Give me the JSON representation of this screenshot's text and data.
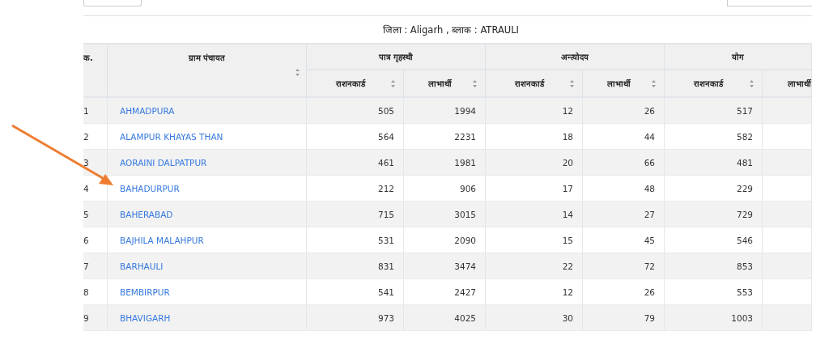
{
  "caption": "जिला : Aligarh , ब्लाक : ATRAULI",
  "header_groups": [
    {
      "label": "क.",
      "sortable": false
    },
    {
      "label": "ग्राम पंचायत",
      "sortable": true
    },
    {
      "label": "पात्र गृहस्थी"
    },
    {
      "label": "अन्त्योदय"
    },
    {
      "label": "योग"
    }
  ],
  "sub_columns": [
    {
      "label": "राशनकार्ड",
      "sortable": true
    },
    {
      "label": "लाभार्थी",
      "sortable": true
    },
    {
      "label": "राशनकार्ड",
      "sortable": true
    },
    {
      "label": "लाभार्थी",
      "sortable": true
    },
    {
      "label": "राशनकार्ड",
      "sortable": true
    },
    {
      "label": "लाभार्थी",
      "sortable": false
    }
  ],
  "rows": [
    {
      "sno": "1",
      "village": "AHMADPURA",
      "values": [
        "505",
        "1994",
        "12",
        "26",
        "517"
      ]
    },
    {
      "sno": "2",
      "village": "ALAMPUR KHAYAS THAN",
      "values": [
        "564",
        "2231",
        "18",
        "44",
        "582"
      ]
    },
    {
      "sno": "3",
      "village": "AORAINI DALPATPUR",
      "values": [
        "461",
        "1981",
        "20",
        "66",
        "481"
      ]
    },
    {
      "sno": "4",
      "village": "BAHADURPUR",
      "values": [
        "212",
        "906",
        "17",
        "48",
        "229"
      ]
    },
    {
      "sno": "5",
      "village": "BAHERABAD",
      "values": [
        "715",
        "3015",
        "14",
        "27",
        "729"
      ]
    },
    {
      "sno": "6",
      "village": "BAJHILA MALAHPUR",
      "values": [
        "531",
        "2090",
        "15",
        "45",
        "546"
      ]
    },
    {
      "sno": "7",
      "village": "BARHAULI",
      "values": [
        "831",
        "3474",
        "22",
        "72",
        "853"
      ]
    },
    {
      "sno": "8",
      "village": "BEMBIRPUR",
      "values": [
        "541",
        "2427",
        "12",
        "26",
        "553"
      ]
    },
    {
      "sno": "9",
      "village": "BHAVIGARH",
      "values": [
        "973",
        "4025",
        "30",
        "79",
        "1003"
      ]
    }
  ]
}
